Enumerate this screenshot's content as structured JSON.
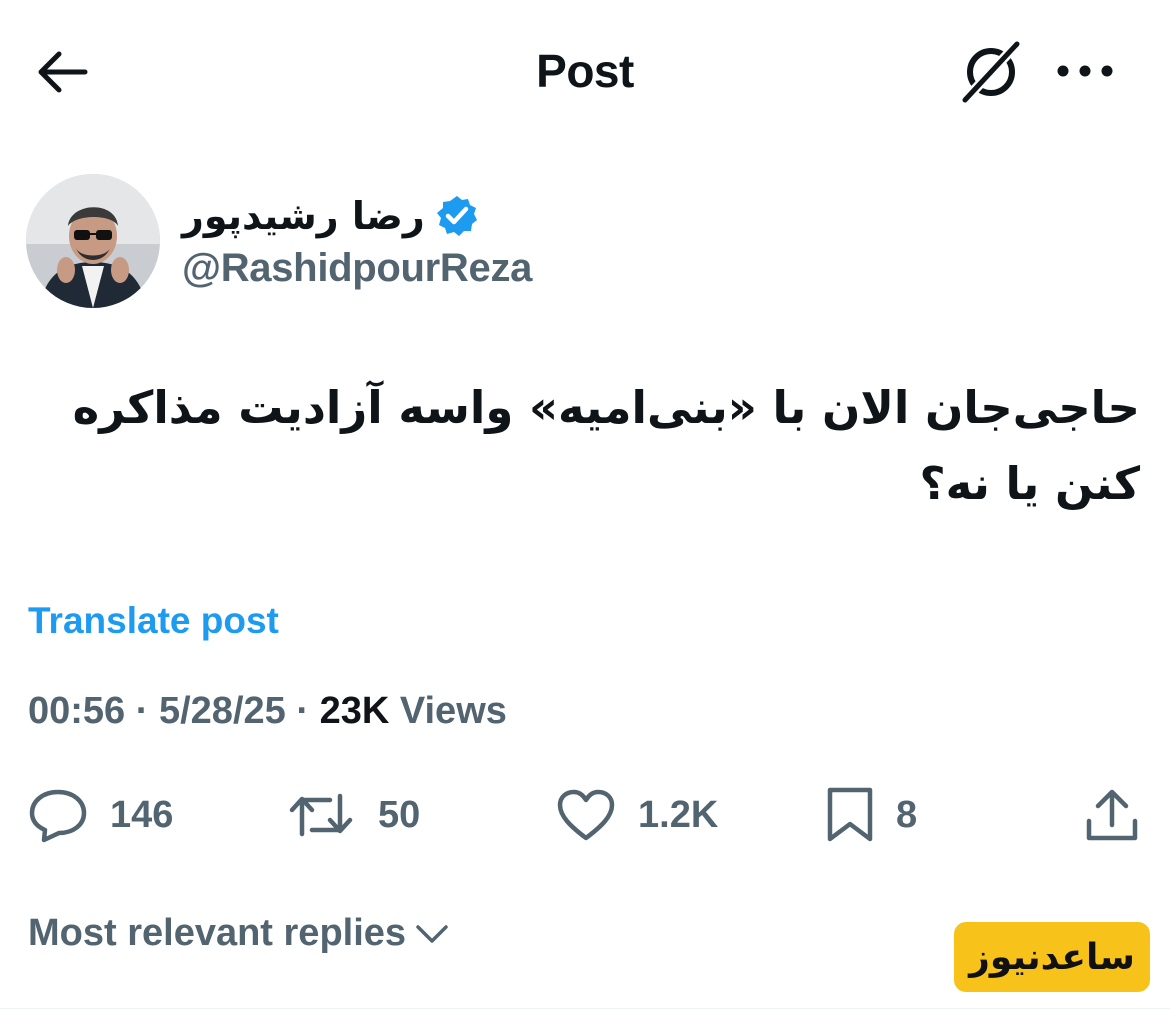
{
  "header": {
    "title": "Post",
    "back_icon": "arrow-left-icon",
    "grok_icon": "grok-icon",
    "more_icon": "more-horizontal-icon"
  },
  "author": {
    "display_name": "رضا رشیدپور",
    "handle": "@RashidpourReza",
    "verified": true,
    "verified_color": "#1d9bf0"
  },
  "post": {
    "text": "حاجی‌جان الان با «بنی‌امیه» واسه آزادیت مذاکره کنن یا نه؟",
    "translate_label": "Translate post",
    "time": "00:56",
    "date": "5/28/25",
    "views_count": "23K",
    "views_label": "Views",
    "separator": "·"
  },
  "actions": {
    "replies": "146",
    "reposts": "50",
    "likes": "1.2K",
    "bookmarks": "8"
  },
  "replies_sort": {
    "label": "Most relevant replies"
  },
  "watermark": {
    "text": "ساعدنیوز",
    "color": "#f7c21a"
  },
  "colors": {
    "text_primary": "#0f1419",
    "text_secondary": "#536471",
    "link": "#1d9bf0"
  }
}
